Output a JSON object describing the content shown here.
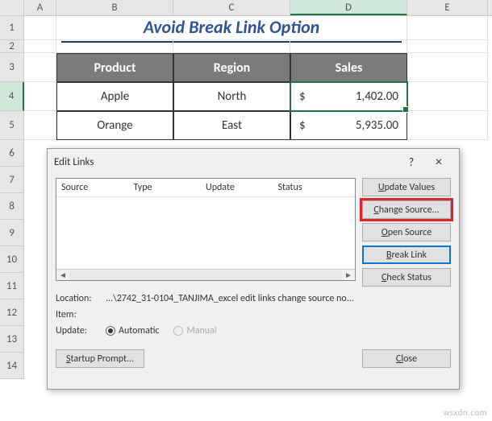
{
  "columns": {
    "A": "A",
    "B": "B",
    "C": "C",
    "D": "D",
    "E": "E"
  },
  "rownums": [
    "1",
    "2",
    "3",
    "4",
    "5",
    "6",
    "7",
    "8",
    "9",
    "10",
    "11",
    "12",
    "13",
    "14"
  ],
  "title": "Avoid Break Link Option",
  "table": {
    "headers": {
      "product": "Product",
      "region": "Region",
      "sales": "Sales"
    },
    "rows": [
      {
        "product": "Apple",
        "region": "North",
        "cur": "$",
        "sales": "1,402.00"
      },
      {
        "product": "Orange",
        "region": "East",
        "cur": "$",
        "sales": "5,935.00"
      }
    ]
  },
  "dialog": {
    "title": "Edit Links",
    "help": "?",
    "close": "×",
    "list_headers": {
      "source": "Source",
      "type": "Type",
      "update": "Update",
      "status": "Status"
    },
    "buttons": {
      "update_values": "pdate Values",
      "update_values_u": "U",
      "change_source": "hange Source...",
      "change_source_u": "C",
      "open_source": "pen Source",
      "open_source_u": "O",
      "break_link": "reak Link",
      "break_link_u": "B",
      "check_status": "heck Status",
      "check_status_u": "C",
      "startup": "tartup Prompt...",
      "startup_u": "S",
      "close_btn": "ose",
      "close_btn_u": "Cl"
    },
    "info": {
      "location_lbl": "Location:",
      "location_val": "...\\2742_31-0104_TANJIMA_excel edit links change source no...",
      "item_lbl": "Item:",
      "update_lbl": "Update:",
      "automatic": "Automatic",
      "manual": "Manual"
    }
  },
  "watermark": "wsxdn.com"
}
